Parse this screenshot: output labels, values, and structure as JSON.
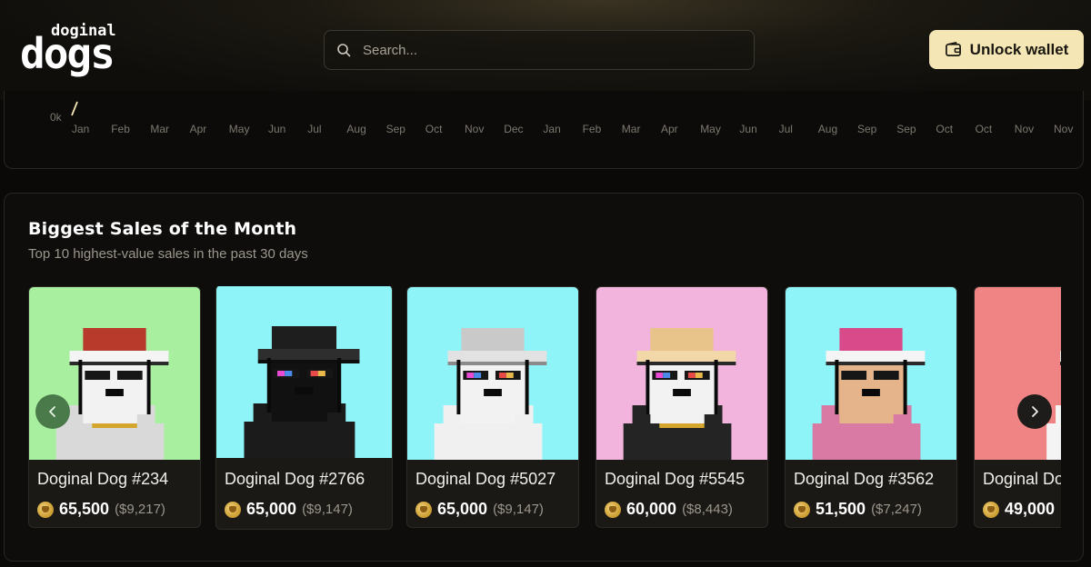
{
  "header": {
    "logo_top": "doginal",
    "logo_bottom": "dogs",
    "search_placeholder": "Search...",
    "unlock_label": "Unlock wallet",
    "accent_color": "#f5e6b5"
  },
  "chart": {
    "y_tick": "0k",
    "months": [
      "Jan",
      "Feb",
      "Mar",
      "Apr",
      "May",
      "Jun",
      "Jul",
      "Aug",
      "Sep",
      "Oct",
      "Nov",
      "Dec",
      "Jan",
      "Feb",
      "Mar",
      "Apr",
      "May",
      "Jun",
      "Jul",
      "Aug",
      "Sep",
      "Sep",
      "Oct",
      "Oct",
      "Nov",
      "Nov"
    ]
  },
  "sales": {
    "title": "Biggest Sales of the Month",
    "subtitle": "Top 10 highest-value sales in the past 30 days",
    "cards": [
      {
        "name": "Doginal Dog #234",
        "doge": "65,500",
        "usd": "($9,217)",
        "bg": "#a8f0a0",
        "hat": "cap-red"
      },
      {
        "name": "Doginal Dog #2766",
        "doge": "65,000",
        "usd": "($9,147)",
        "bg": "#8ef4f8",
        "hat": "fedora-black"
      },
      {
        "name": "Doginal Dog #5027",
        "doge": "65,000",
        "usd": "($9,147)",
        "bg": "#8ef4f8",
        "hat": "fedora-white"
      },
      {
        "name": "Doginal Dog #5545",
        "doge": "60,000",
        "usd": "($8,443)",
        "bg": "#f2b4dc",
        "hat": "dog-ears"
      },
      {
        "name": "Doginal Dog #3562",
        "doge": "51,500",
        "usd": "($7,247)",
        "bg": "#8ef4f8",
        "hat": "cap-pink"
      },
      {
        "name": "Doginal Dog",
        "doge": "49,000",
        "usd": "",
        "bg": "#f08484",
        "hat": "partial"
      }
    ]
  }
}
